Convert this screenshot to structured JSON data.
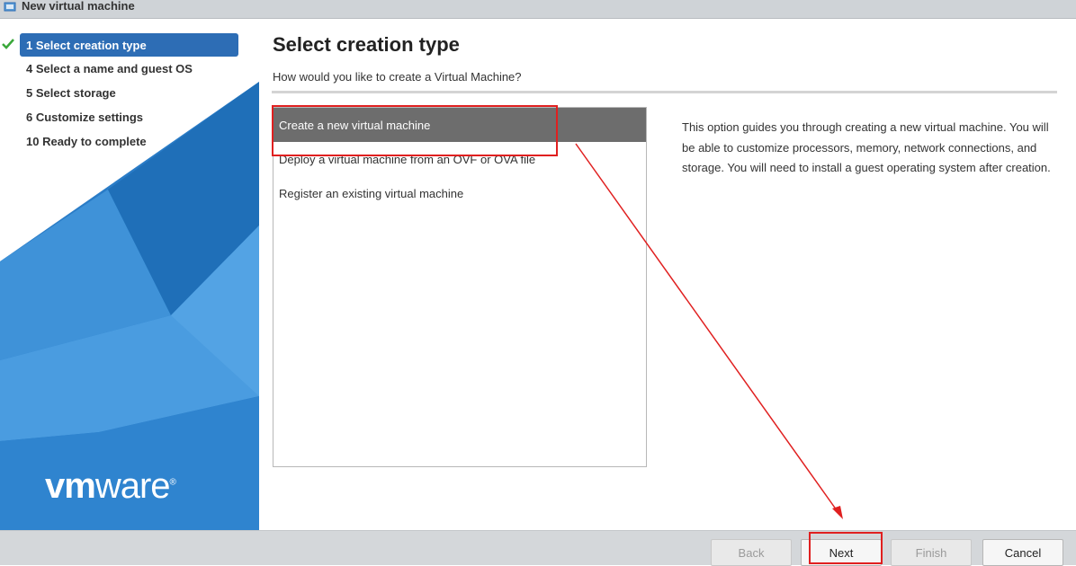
{
  "window": {
    "title": "New virtual machine",
    "icon": "vm-window-icon"
  },
  "wizard": {
    "steps": [
      {
        "label": "1 Select creation type",
        "active": true,
        "completed": true
      },
      {
        "label": "4 Select a name and guest OS",
        "active": false
      },
      {
        "label": "5 Select storage",
        "active": false
      },
      {
        "label": "6 Customize settings",
        "active": false
      },
      {
        "label": "10 Ready to complete",
        "active": false
      }
    ],
    "logo": {
      "bold": "vm",
      "regular": "ware",
      "mark": "®"
    }
  },
  "main": {
    "title": "Select creation type",
    "subtitle": "How would you like to create a Virtual Machine?",
    "options": [
      {
        "label": "Create a new virtual machine",
        "selected": true
      },
      {
        "label": "Deploy a virtual machine from an OVF or OVA file",
        "selected": false
      },
      {
        "label": "Register an existing virtual machine",
        "selected": false
      }
    ],
    "description": "This option guides you through creating a new virtual machine. You will be able to customize processors, memory, network connections, and storage. You will need to install a guest operating system after creation."
  },
  "footer": {
    "back_label": "Back",
    "next_label": "Next",
    "finish_label": "Finish",
    "cancel_label": "Cancel"
  },
  "colors": {
    "accent": "#2d6db5",
    "selected_row": "#6d6d6d",
    "annotation": "#e02020",
    "check": "#3aa83a"
  }
}
